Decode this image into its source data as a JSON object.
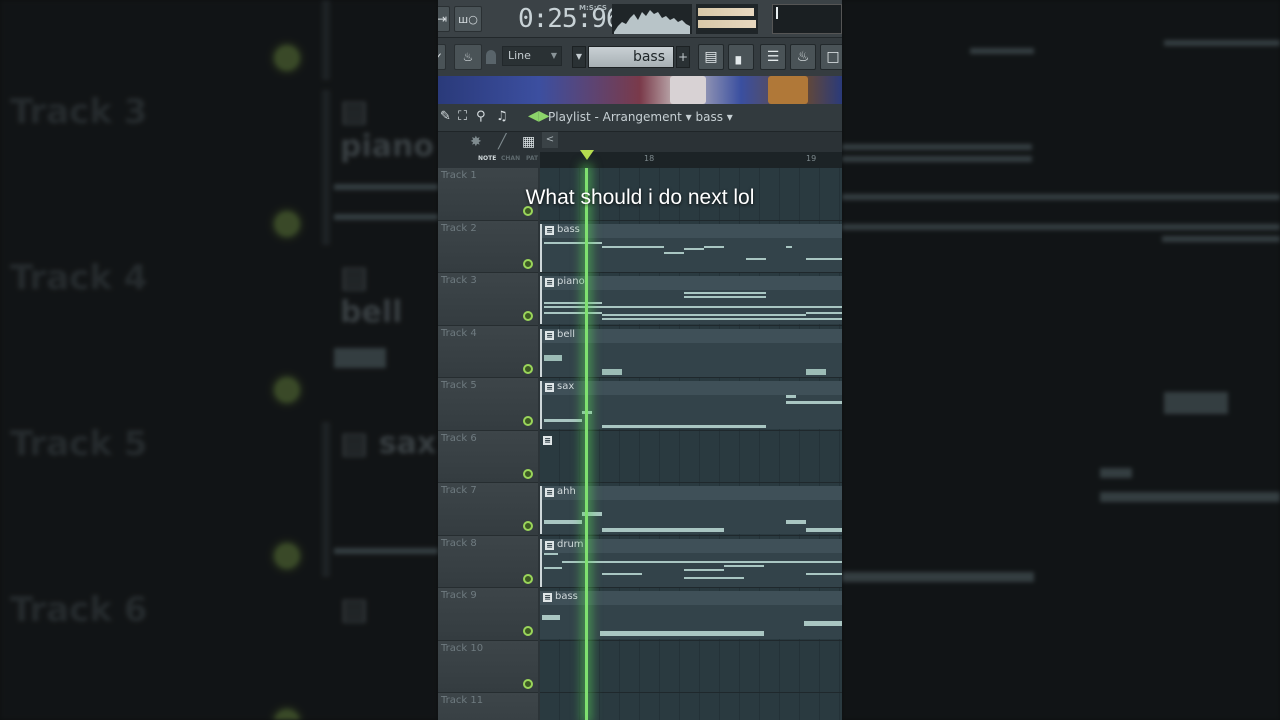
{
  "toolbar": {
    "time_display": "0:25:96",
    "time_format_label": "M:S:CS",
    "snap_mode": "Line",
    "pattern_name": "bass",
    "pattern_add": "+"
  },
  "playlist": {
    "title": "Playlist - Arrangement",
    "pattern_selector": "bass",
    "tabs": [
      "NOTE",
      "CHAN",
      "PAT"
    ],
    "ruler_numbers": [
      "18",
      "19"
    ]
  },
  "tracks": [
    {
      "name": "Track 1",
      "clip": null
    },
    {
      "name": "Track 2",
      "clip": "bass"
    },
    {
      "name": "Track 3",
      "clip": "piano"
    },
    {
      "name": "Track 4",
      "clip": "bell"
    },
    {
      "name": "Track 5",
      "clip": "sax"
    },
    {
      "name": "Track 6",
      "clip": ""
    },
    {
      "name": "Track 7",
      "clip": "ahh"
    },
    {
      "name": "Track 8",
      "clip": "drum"
    },
    {
      "name": "Track 9",
      "clip": "bass"
    },
    {
      "name": "Track 10",
      "clip": null
    },
    {
      "name": "Track 11",
      "clip": null
    }
  ],
  "background": {
    "tracks": [
      "Track 3",
      "Track 4",
      "Track 5",
      "Track 6"
    ],
    "labels": [
      "piano",
      "bell",
      "sax",
      ""
    ]
  },
  "caption": "What should i do next lol",
  "colors": {
    "playhead": "#7fe070",
    "led": "#9ad55a",
    "panel": "#2c3438"
  }
}
